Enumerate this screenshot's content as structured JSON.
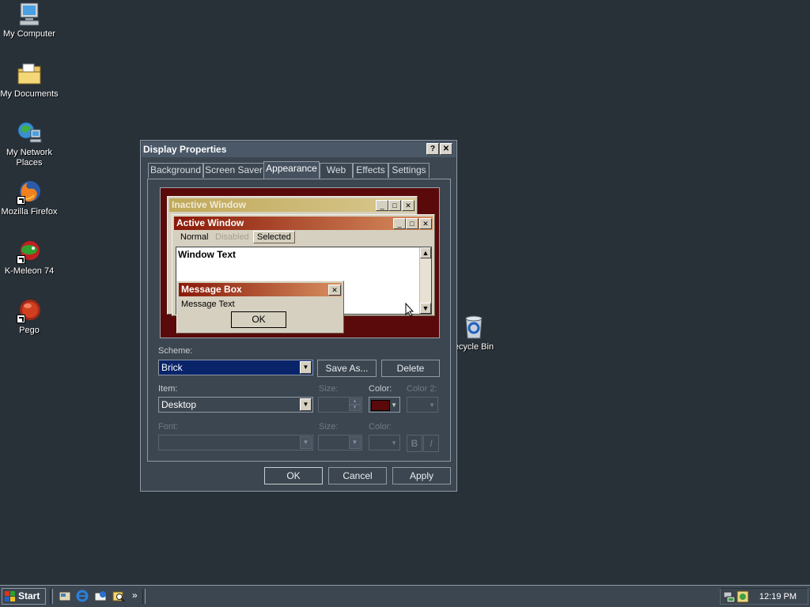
{
  "desktop": {
    "icons": [
      {
        "label": "My Computer"
      },
      {
        "label": "My Documents"
      },
      {
        "label": "My Network Places"
      },
      {
        "label": "Mozilla Firefox"
      },
      {
        "label": "K-Meleon 74"
      },
      {
        "label": "Pego"
      },
      {
        "label": "ecycle Bin"
      }
    ]
  },
  "dialog": {
    "title": "Display Properties",
    "help_btn": "?",
    "close_btn": "✕",
    "tabs": [
      {
        "label": "Background"
      },
      {
        "label": "Screen Saver"
      },
      {
        "label": "Appearance"
      },
      {
        "label": "Web"
      },
      {
        "label": "Effects"
      },
      {
        "label": "Settings"
      }
    ],
    "preview": {
      "inactive_title": "Inactive Window",
      "active_title": "Active Window",
      "menu_normal": "Normal",
      "menu_disabled": "Disabled",
      "menu_selected": "Selected",
      "window_text": "Window Text",
      "msgbox_title": "Message Box",
      "msgbox_text": "Message Text",
      "msgbox_ok": "OK"
    },
    "scheme": {
      "label": "Scheme:",
      "value": "Brick",
      "save_as": "Save As...",
      "delete": "Delete"
    },
    "item": {
      "label": "Item:",
      "value": "Desktop",
      "size_label": "Size:",
      "color_label": "Color:",
      "color2_label": "Color 2:",
      "color_value": "#5a0a0a"
    },
    "font": {
      "label": "Font:",
      "size_label": "Size:",
      "color_label": "Color:",
      "bold": "B",
      "italic": "I"
    },
    "buttons": {
      "ok": "OK",
      "cancel": "Cancel",
      "apply": "Apply"
    }
  },
  "taskbar": {
    "start_label": "Start",
    "chevron": "»",
    "clock": "12:19 PM"
  },
  "colors": {
    "desktop": "#283038",
    "brick": "#5a0a0a",
    "selection": "#0a246a"
  }
}
